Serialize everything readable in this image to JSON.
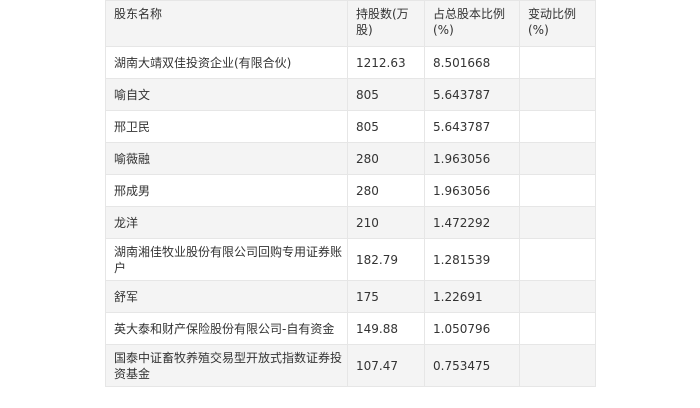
{
  "table": {
    "headers": {
      "name": "股东名称",
      "shares": "持股数(万股)",
      "ratio": "占总股本比例(%)",
      "change": "变动比例(%)"
    },
    "rows": [
      {
        "name": "湖南大靖双佳投资企业(有限合伙)",
        "shares": "1212.63",
        "ratio": "8.501668",
        "change": ""
      },
      {
        "name": "喻自文",
        "shares": "805",
        "ratio": "5.643787",
        "change": ""
      },
      {
        "name": "邢卫民",
        "shares": "805",
        "ratio": "5.643787",
        "change": ""
      },
      {
        "name": "喻薇融",
        "shares": "280",
        "ratio": "1.963056",
        "change": ""
      },
      {
        "name": "邢成男",
        "shares": "280",
        "ratio": "1.963056",
        "change": ""
      },
      {
        "name": "龙洋",
        "shares": "210",
        "ratio": "1.472292",
        "change": ""
      },
      {
        "name": "湖南湘佳牧业股份有限公司回购专用证券账户",
        "shares": "182.79",
        "ratio": "1.281539",
        "change": ""
      },
      {
        "name": "舒军",
        "shares": "175",
        "ratio": "1.22691",
        "change": ""
      },
      {
        "name": "英大泰和财产保险股份有限公司-自有资金",
        "shares": "149.88",
        "ratio": "1.050796",
        "change": ""
      },
      {
        "name": "国泰中证畜牧养殖交易型开放式指数证券投资基金",
        "shares": "107.47",
        "ratio": "0.753475",
        "change": ""
      }
    ]
  }
}
